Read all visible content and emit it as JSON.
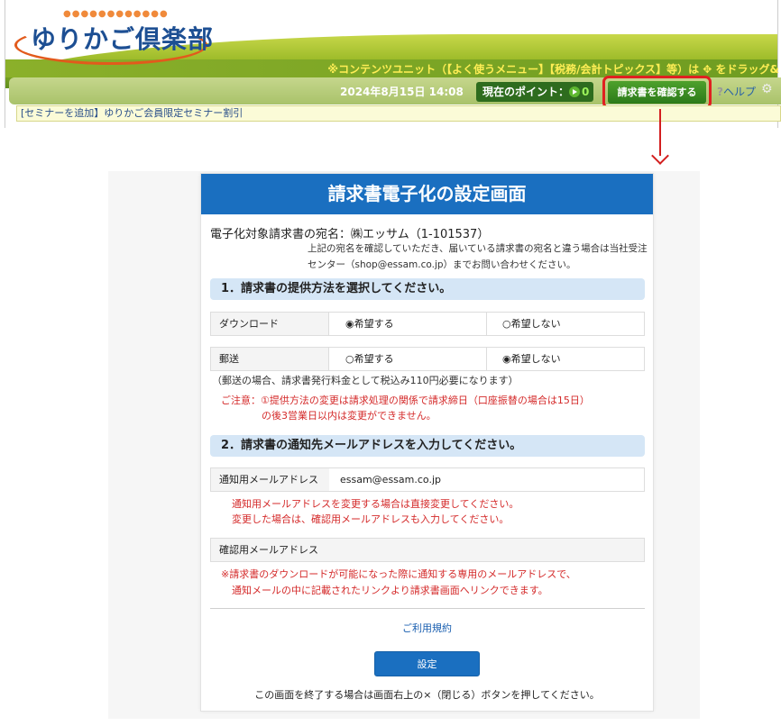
{
  "header": {
    "logo_text": "ゆりかご倶楽部",
    "notice": "※コンテンツユニット（【よく使うメニュー】【税務/会計トピックス】等）は ✥ をドラッグ&",
    "datetime": "2024年8月15日 14:08",
    "points_label": "現在のポイント：",
    "points_value": "0",
    "invoice_button": "請求書を確認する",
    "help_label": "ヘルプ",
    "ticker": "[セミナーを追加】ゆりかご会員限定セミナー割引"
  },
  "panel": {
    "title": "請求書電子化の設定画面",
    "recipient": "電子化対象請求書の宛名：㈱エッサム（1-101537）",
    "recipient_note": "上記の宛名を確認していただき、届いている請求書の宛名と違う場合は当社受注センター（shop@essam.co.jp）までお問い合わせください。",
    "section1": "1．請求書の提供方法を選択してください。",
    "download": {
      "label": "ダウンロード",
      "option_yes": "◉希望する",
      "option_no": "○希望しない"
    },
    "postal": {
      "label": "郵送",
      "option_yes": "○希望する",
      "option_no": "◉希望しない"
    },
    "postal_note": "（郵送の場合、請求書発行料金として税込み110円必要になります）",
    "caution_line1": "ご注意：①提供方法の変更は請求処理の関係で請求締日（口座振替の場合は15日）",
    "caution_line2": "の後3営業日以内は変更ができません。",
    "section2": "2．請求書の通知先メールアドレスを入力してください。",
    "email": {
      "label": "通知用メールアドレス",
      "value": "essam@essam.co.jp"
    },
    "email_hint_line1": "通知用メールアドレスを変更する場合は直接変更してください。",
    "email_hint_line2": "変更した場合は、確認用メールアドレスも入力してください。",
    "confirm": {
      "label": "確認用メールアドレス",
      "value": ""
    },
    "notice_line1": "※請求書のダウンロードが可能になった際に通知する専用のメールアドレスで、",
    "notice_line2": "通知メールの中に記載されたリンクより請求書画面へリンクできます。",
    "terms_link": "ご利用規約",
    "set_button": "設定",
    "footer_note": "この画面を終了する場合は画面右上の×（閉じる）ボタンを押してください。"
  },
  "colors": {
    "panel_header": "#1a6fc0",
    "section_head": "#d5e6f6",
    "caution_text": "#d42a2a",
    "highlight_border": "#e02020"
  }
}
